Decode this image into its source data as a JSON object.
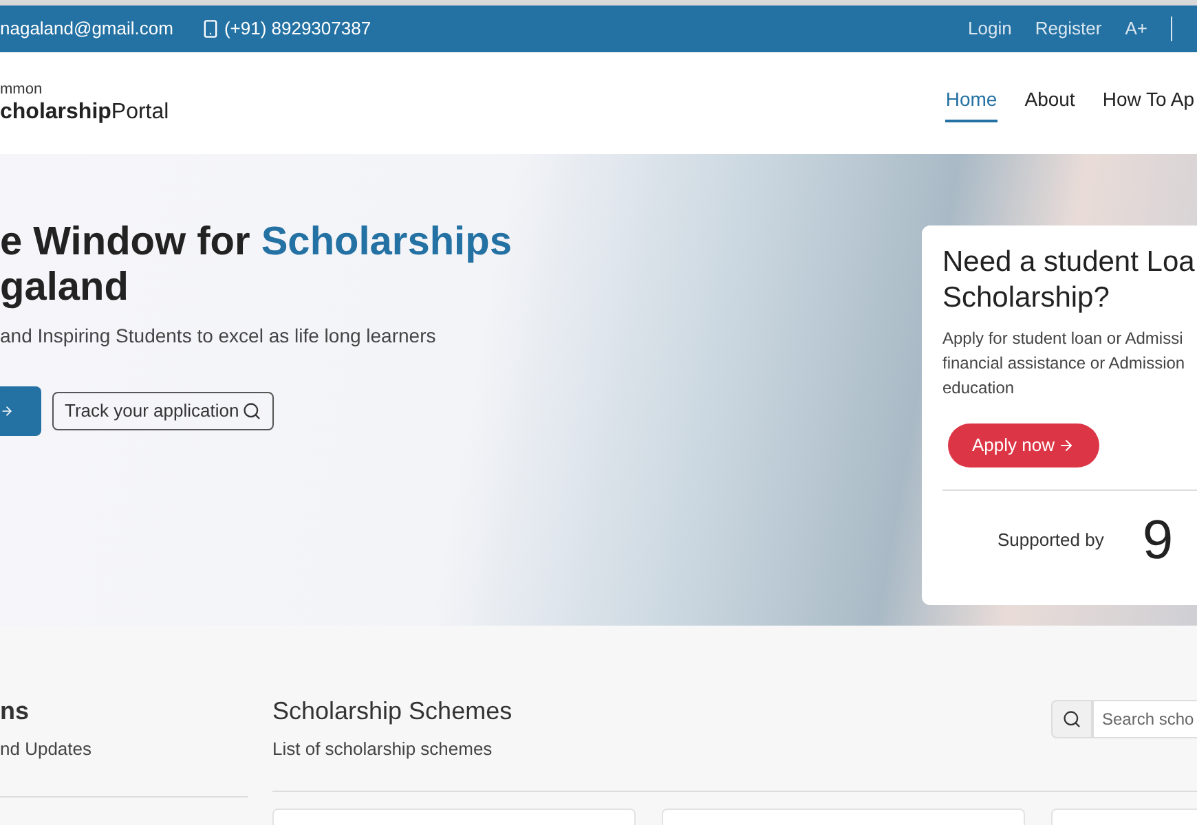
{
  "top_bar": {
    "email": "nagaland@gmail.com",
    "phone": "(+91) 8929307387",
    "links": [
      {
        "label": "Login"
      },
      {
        "label": "Register"
      },
      {
        "label": "A+"
      }
    ]
  },
  "header": {
    "logo_small": "mmon",
    "logo_main": "**cholarship**Portal",
    "nav": [
      {
        "label": "Home",
        "selected": true
      },
      {
        "label": "About",
        "selected": false
      },
      {
        "label": "How To Ap",
        "selected": false
      }
    ]
  },
  "hero": {
    "headline_line_1": [
      {
        "text": "e Window for ",
        "highlight": false
      },
      {
        "text": "Scholarships",
        "highlight": true
      }
    ],
    "headline_line_2": "galand",
    "subtitle": "and Inspiring Students to excel as life long learners",
    "track_button": "Track your application"
  },
  "loan_card": {
    "title_lines": [
      "Need a student Loa",
      "Scholarship?"
    ],
    "description_lines": [
      "Apply for student loan or Admissi",
      "financial assistance or Admission",
      "education"
    ],
    "apply_button": "Apply now",
    "supported_by": "Supported by",
    "logo_text": "9"
  },
  "notifications": {
    "title": "ns",
    "subtitle": "nd Updates"
  },
  "schemes": {
    "title": "Scholarship Schemes",
    "subtitle": "List of scholarship schemes",
    "search": {
      "placeholder": "Search scho"
    }
  }
}
